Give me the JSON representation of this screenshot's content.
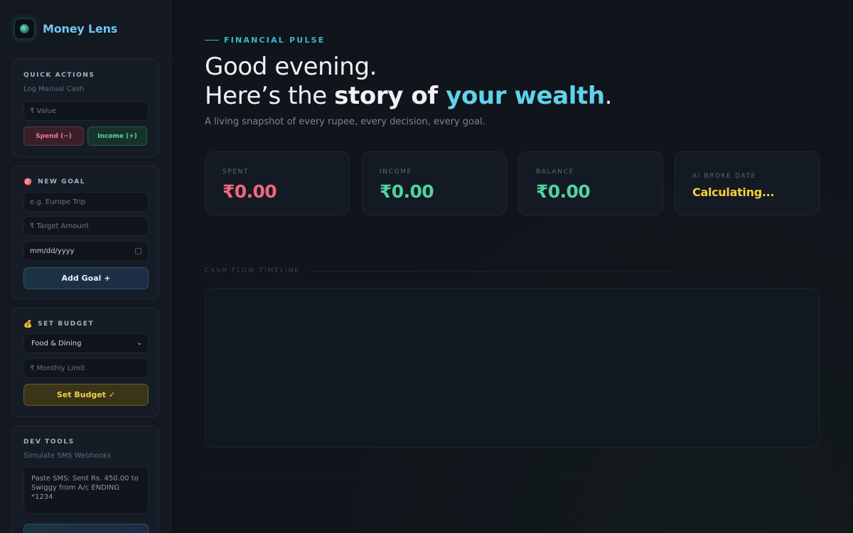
{
  "app": {
    "name": "Money Lens",
    "logo_icon": "globe-icon"
  },
  "sidebar": {
    "quick_actions": {
      "title": "QUICK ACTIONS",
      "subtitle": "Log Manual Cash",
      "value_placeholder": "₹ Value",
      "spend_label": "Spend (−)",
      "income_label": "Income (+)"
    },
    "new_goal": {
      "emoji": "🎯",
      "title": "NEW GOAL",
      "name_placeholder": "e.g. Europe Trip",
      "amount_placeholder": "₹ Target Amount",
      "date_value": "mm/dd/yyyy",
      "add_label": "Add Goal +"
    },
    "set_budget": {
      "emoji": "💰",
      "title": "SET BUDGET",
      "category_selected": "Food & Dining",
      "limit_placeholder": "₹ Monthly Limit",
      "set_label": "Set Budget ✓"
    },
    "dev_tools": {
      "title": "DEV TOOLS",
      "subtitle": "Simulate SMS Webhooks",
      "sms_placeholder": "Paste SMS: Sent Rs. 450.00 to Swiggy from A/c ENDING *1234"
    }
  },
  "main": {
    "eyebrow": "FINANCIAL PULSE",
    "greeting_line1": "Good evening.",
    "greeting_line2_pre": "Here’s the ",
    "greeting_line2_bold": "story of ",
    "greeting_line2_accent": "your wealth",
    "greeting_line2_post": ".",
    "tagline": "A living snapshot of every rupee, every decision, every goal.",
    "stats": [
      {
        "label": "SPENT",
        "value": "₹0.00",
        "color": "#f0677f"
      },
      {
        "label": "INCOME",
        "value": "₹0.00",
        "color": "#4fd3a0"
      },
      {
        "label": "BALANCE",
        "value": "₹0.00",
        "color": "#4fd3a0"
      },
      {
        "label": "AI BROKE DATE",
        "value": "Calculating...",
        "color": "#f2cf3a"
      }
    ],
    "timeline_label": "CASH FLOW TIMELINE"
  },
  "colors": {
    "background": "#10141b",
    "accent": "#5fd3ea",
    "spend": "#f0677f",
    "income": "#4fd3a0",
    "warning": "#f2cf3a"
  }
}
